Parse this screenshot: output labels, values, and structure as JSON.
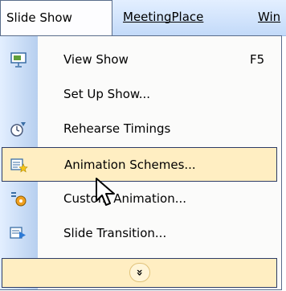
{
  "menubar": {
    "open_menu": "Slide Show",
    "items": [
      "Slide Show",
      "MeetingPlace",
      "Win"
    ]
  },
  "menu": {
    "items": [
      {
        "label": "View Show",
        "shortcut": "F5",
        "icon": "view-show-icon"
      },
      {
        "label": "Set Up Show...",
        "icon": ""
      },
      {
        "label": "Rehearse Timings",
        "icon": "rehearse-timings-icon"
      },
      {
        "label": "Animation Schemes...",
        "icon": "animation-schemes-icon",
        "highlighted": true
      },
      {
        "label": "Custom Animation...",
        "icon": "custom-animation-icon"
      },
      {
        "label": "Slide Transition...",
        "icon": "slide-transition-icon"
      }
    ],
    "expand_glyph": "»"
  },
  "colors": {
    "menubar_top": "#e3efff",
    "menubar_bottom": "#c3daf9",
    "highlight": "#ffeec2",
    "highlight_border": "#2d3c66",
    "gutter": "#b7cfef"
  }
}
